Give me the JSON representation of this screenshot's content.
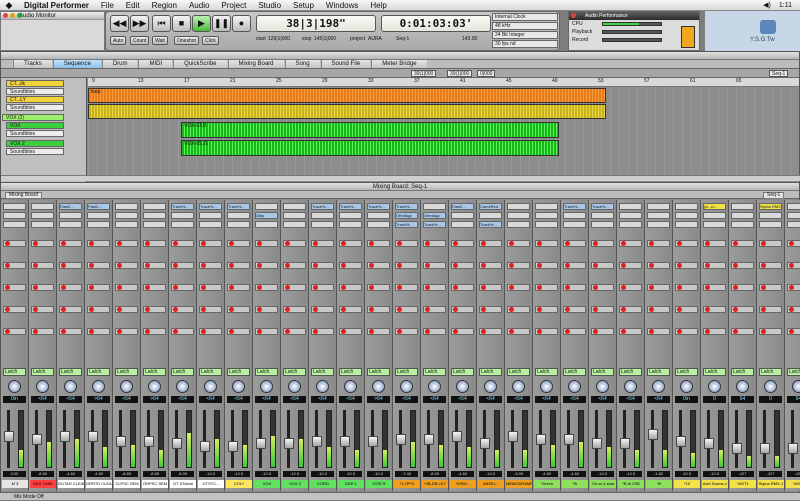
{
  "menubar": {
    "app": "Digital Performer",
    "items": [
      "File",
      "Edit",
      "Region",
      "Audio",
      "Project",
      "Studio",
      "Setup",
      "Windows",
      "Help"
    ],
    "time": "1:11"
  },
  "audio_monitor": {
    "title": "Audio Monitor"
  },
  "control_panel": {
    "counter": "38|3|198",
    "counter_suffix": "\"",
    "time": "0:01:03:03",
    "time_suffix": "'",
    "start_label": "start",
    "start_value": "129|1|000",
    "stop_label": "stop",
    "stop_value": "145|1|000",
    "project_label": "project",
    "project_value": "AURA",
    "seq": "Seq-1",
    "tempo": "143.00",
    "sample_rate": "48 kHz",
    "bit_depth": "24 Bit Integer",
    "fps": "30 fps nd",
    "clock": "Internal Clock",
    "buttons": {
      "rewind_fast": "◀◀",
      "fast_forward": "▶▶",
      "start": "⏮",
      "stop": "■",
      "play": "▶",
      "pause": "❚❚",
      "record": "●"
    },
    "sub_buttons": [
      "Auto",
      "Count",
      "Wait",
      "Oneshot",
      "Click"
    ]
  },
  "audio_performance": {
    "title": "Audio Performance",
    "cpu_label": "CPU",
    "cpu_level": 0.62,
    "playback_label": "Playback",
    "playback_level": 0.0,
    "record_label": "Record",
    "record_level": 0.0
  },
  "logo": {
    "text": "Y.S.G.Tw"
  },
  "sequence_window": {
    "tabs": [
      "Tracks",
      "Sequence",
      "Drum",
      "MIDI",
      "QuickScribe",
      "Mixing Board",
      "Song",
      "Sound File",
      "Meter Bridge"
    ],
    "selected_tab": "Sequence",
    "locate_start": "39|1|000",
    "locate_end": "39|1|000",
    "locate_offset": "0|000",
    "seq_menu": "Seq-1",
    "ruler": [
      "9",
      "13",
      "17",
      "21",
      "25",
      "29",
      "33",
      "37",
      "41",
      "45",
      "49",
      "53",
      "57",
      "61",
      "65"
    ],
    "tracks": [
      {
        "name": "CT...ilk",
        "kind": "sel"
      },
      {
        "name": "Soundbites",
        "kind": "sub"
      },
      {
        "name": "CT...LY",
        "kind": "sel"
      },
      {
        "name": "Soundbites",
        "kind": "sub"
      },
      {
        "name": "VOX (2)",
        "kind": "vox"
      },
      {
        "name": "VOX",
        "kind": "green"
      },
      {
        "name": "Soundbites",
        "kind": "sub"
      },
      {
        "name": "VOX 2",
        "kind": "green"
      },
      {
        "name": "Soundbites",
        "kind": "sub"
      }
    ],
    "regions": [
      "loop",
      "VOX-03.8",
      "VOX-05.2)"
    ]
  },
  "mixing_board": {
    "title": "Mixing Board: Seq-1",
    "seq_menu": "Seq-1",
    "toolbar_label": "Mixing Board",
    "automation": "Latch",
    "strips": [
      {
        "name": "M 3",
        "inserts": [
          "",
          "",
          ""
        ],
        "ins_color": "",
        "pan": "0in",
        "vol": "0.00",
        "meter": 0.3,
        "fader": 0.55,
        "nameColor": "#e6e6e6"
      },
      {
        "name": "BAS TUBE",
        "inserts": [
          "",
          "",
          ""
        ],
        "ins_color": "",
        "pan": "<64",
        "vol": "-8.50",
        "meter": 0.45,
        "fader": 0.5,
        "nameColor": "#ff4040"
      },
      {
        "name": "GUTAR CLEAN",
        "inserts": [
          "FastC...",
          "",
          ""
        ],
        "ins_color": "",
        "pan": "<64",
        "vol": "-4.60",
        "meter": 0.5,
        "fader": 0.55,
        "nameColor": "#ffffff"
      },
      {
        "name": "GRRTD CLEAN",
        "inserts": [
          "FastC...",
          "",
          ""
        ],
        "ins_color": "",
        "pan": ">64",
        "vol": "-4.60",
        "meter": 0.35,
        "fader": 0.55,
        "nameColor": "#ffffff"
      },
      {
        "name": "CLPSC SEM",
        "inserts": [
          "",
          "",
          ""
        ],
        "ins_color": "",
        "pan": "<64",
        "vol": "-8.65",
        "meter": 0.4,
        "fader": 0.45,
        "nameColor": "#ffffff"
      },
      {
        "name": "GRPSC SEM",
        "inserts": [
          "",
          "",
          ""
        ],
        "ins_color": "",
        "pan": ">64",
        "vol": "-8.65",
        "meter": 0.3,
        "fader": 0.45,
        "nameColor": "#ffffff"
      },
      {
        "name": "GT STclickl",
        "inserts": [
          "Track%...",
          "",
          ""
        ],
        "ins_color": "",
        "pan": "<64",
        "vol": "-8.00",
        "meter": 0.6,
        "fader": 0.4,
        "nameColor": "#ffffff"
      },
      {
        "name": "GTSTC...",
        "inserts": [
          "Track%...",
          "",
          ""
        ],
        "ins_color": "",
        "pan": "<64",
        "vol": "-14.0",
        "meter": 0.5,
        "fader": 0.35,
        "nameColor": "#ffffff"
      },
      {
        "name": "COLY",
        "inserts": [
          "Track%...",
          "",
          ""
        ],
        "ins_color": "",
        "pan": "<64",
        "vol": "-14.0",
        "meter": 0.4,
        "fader": 0.35,
        "nameColor": "#ffe860"
      },
      {
        "name": "VOX",
        "inserts": [
          "",
          "Dbly",
          ""
        ],
        "ins_color": "",
        "pan": "<64",
        "vol": "-12.5",
        "meter": 0.55,
        "fader": 0.4,
        "nameColor": "#62e062"
      },
      {
        "name": "VOX 2",
        "inserts": [
          "",
          "",
          ""
        ],
        "ins_color": "",
        "pan": "<64",
        "vol": "-12.5",
        "meter": 0.5,
        "fader": 0.4,
        "nameColor": "#62e062"
      },
      {
        "name": "CORD",
        "inserts": [
          "Track%...",
          "",
          ""
        ],
        "ins_color": "",
        "pan": "<64",
        "vol": "-10.0",
        "meter": 0.35,
        "fader": 0.45,
        "nameColor": "#62e062"
      },
      {
        "name": "DDR L",
        "inserts": [
          "Track%...",
          "",
          ""
        ],
        "ins_color": "",
        "pan": "<64",
        "vol": "-10.0",
        "meter": 0.3,
        "fader": 0.45,
        "nameColor": "#62e062"
      },
      {
        "name": "COR R",
        "inserts": [
          "Track%...",
          "",
          ""
        ],
        "ins_color": "",
        "pan": ">64",
        "vol": "-10.0",
        "meter": 0.3,
        "fader": 0.45,
        "nameColor": "#62e062"
      },
      {
        "name": "*1 LPFX",
        "inserts": [
          "Track%...",
          "OfnrAlgo",
          "Track%..."
        ],
        "ins_color": "",
        "pan": "<64",
        "vol": "-7.40",
        "meter": 0.45,
        "fader": 0.5,
        "nameColor": "#f0a020"
      },
      {
        "name": "*2B-DB LKY",
        "inserts": [
          "",
          "OfnrAlgo",
          "Track%..."
        ],
        "ins_color": "",
        "pan": "<64",
        "vol": "-8.00",
        "meter": 0.4,
        "fader": 0.5,
        "nameColor": "#f0a020"
      },
      {
        "name": "*DRM...",
        "inserts": [
          "FastC...",
          "",
          ""
        ],
        "ins_color": "",
        "pan": "<64",
        "vol": "-4.60",
        "meter": 0.35,
        "fader": 0.55,
        "nameColor": "#f0a020"
      },
      {
        "name": "UNSEL...",
        "inserts": [
          "CameRed",
          "",
          "Track%..."
        ],
        "ins_color": "",
        "pan": "<64",
        "vol": "-14.0",
        "meter": 0.3,
        "fader": 0.4,
        "nameColor": "#f0a020"
      },
      {
        "name": "MEMODRAMP",
        "inserts": [
          "",
          "",
          ""
        ],
        "ins_color": "",
        "pan": "<64",
        "vol": "-3.00",
        "meter": 0.3,
        "fader": 0.55,
        "nameColor": "#f0a020"
      },
      {
        "name": "*Drevs",
        "inserts": [
          "",
          "",
          ""
        ],
        "ins_color": "",
        "pan": "<64",
        "vol": "-4.60",
        "meter": 0.4,
        "fader": 0.5,
        "nameColor": "#90e060"
      },
      {
        "name": "*B",
        "inserts": [
          "Track%...",
          "",
          ""
        ],
        "ins_color": "",
        "pan": "<64",
        "vol": "-4.60",
        "meter": 0.45,
        "fader": 0.5,
        "nameColor": "#90e060"
      },
      {
        "name": "*2s a/-4 shar",
        "inserts": [
          "Track%...",
          "",
          ""
        ],
        "ins_color": "",
        "pan": "<64",
        "vol": "-14.0",
        "meter": 0.35,
        "fader": 0.4,
        "nameColor": "#90e060"
      },
      {
        "name": "*B Al 2SB",
        "inserts": [
          "",
          "",
          ""
        ],
        "ins_color": "",
        "pan": "<64",
        "vol": "-14.0",
        "meter": 0.3,
        "fader": 0.4,
        "nameColor": "#90e060"
      },
      {
        "name": "*B",
        "inserts": [
          "",
          "",
          ""
        ],
        "ins_color": "",
        "pan": "<64",
        "vol": "-1.82",
        "meter": 0.3,
        "fader": 0.6,
        "nameColor": "#90e060"
      },
      {
        "name": "*10",
        "inserts": [
          "",
          "",
          ""
        ],
        "ins_color": "",
        "pan": "0in",
        "vol": "-10.0",
        "meter": 0.25,
        "fader": 0.45,
        "nameColor": "#f4e24a"
      },
      {
        "name": "Acid Drums-1",
        "inserts": [
          "(d...cl...",
          "",
          ""
        ],
        "ins_color": "ylw",
        "pan": "0",
        "vol": "-12.5",
        "meter": 0.3,
        "fader": 0.4,
        "nameColor": "#f4e24a"
      },
      {
        "name": "INST1",
        "inserts": [
          "",
          "",
          ""
        ],
        "ins_color": "",
        "pan": "64",
        "vol": "-127",
        "meter": 0.2,
        "fader": 0.3,
        "nameColor": "#f4e24a"
      },
      {
        "name": "Stylus RMX-1",
        "inserts": [
          "Stylus RMX...",
          "",
          ""
        ],
        "ins_color": "ylw",
        "pan": "0",
        "vol": "-127",
        "meter": 0.2,
        "fader": 0.3,
        "nameColor": "#f4e24a"
      },
      {
        "name": "INST2",
        "inserts": [
          "",
          "",
          ""
        ],
        "ins_color": "",
        "pan": "64",
        "vol": "-127",
        "meter": 0.15,
        "fader": 0.3,
        "nameColor": "#f4e24a"
      }
    ]
  },
  "status": {
    "text": "Mix Mode Off"
  }
}
